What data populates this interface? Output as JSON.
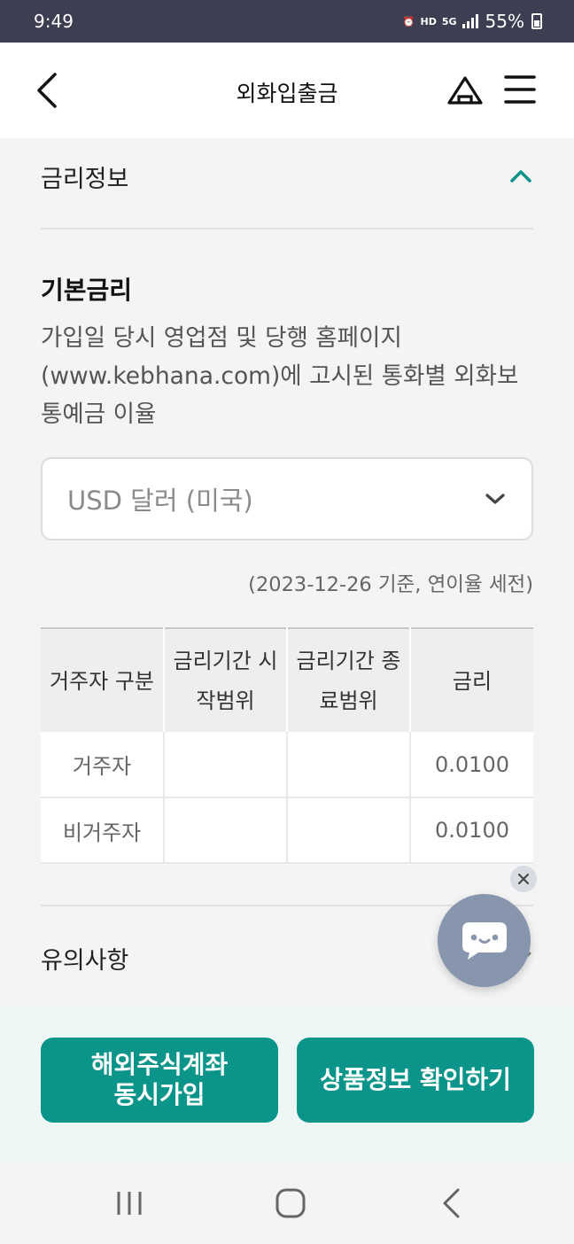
{
  "status_bar": {
    "time": "9:49",
    "battery": "55%",
    "indicators": [
      "alarm-icon",
      "HD",
      "5G",
      "signal-icon"
    ]
  },
  "header": {
    "title": "외화입출금",
    "icons": [
      "back-arrow-icon",
      "home-icon",
      "menu-icon"
    ]
  },
  "rate_section": {
    "title": "금리정보",
    "expanded": true
  },
  "basic_rate": {
    "heading": "기본금리",
    "description": "가입일 당시 영업점 및 당행 홈페이지 (www.kebhana.com)에 고시된 통화별 외화보통예금 이율",
    "currency_select": {
      "selected": "USD 달러 (미국)"
    },
    "basis_note": "(2023-12-26 기준, 연이율 세전)",
    "table": {
      "headers": [
        "거주자 구분",
        "금리기간 시작범위",
        "금리기간 종료범위",
        "금리"
      ],
      "rows": [
        [
          "거주자",
          "",
          "",
          "0.0100"
        ],
        [
          "비거주자",
          "",
          "",
          "0.0100"
        ]
      ]
    }
  },
  "notice_section": {
    "title": "유의사항",
    "expanded": false
  },
  "chat_fab": {
    "icon": "chat-bubble-icon",
    "color": "#8795ad"
  },
  "buttons": {
    "left_label": "해외주식계좌 동시가입",
    "right_label": "상품정보 확인하기",
    "color": "#0b958a"
  },
  "colors": {
    "accent": "#0b958a",
    "status_bar": "#3e3e52"
  }
}
